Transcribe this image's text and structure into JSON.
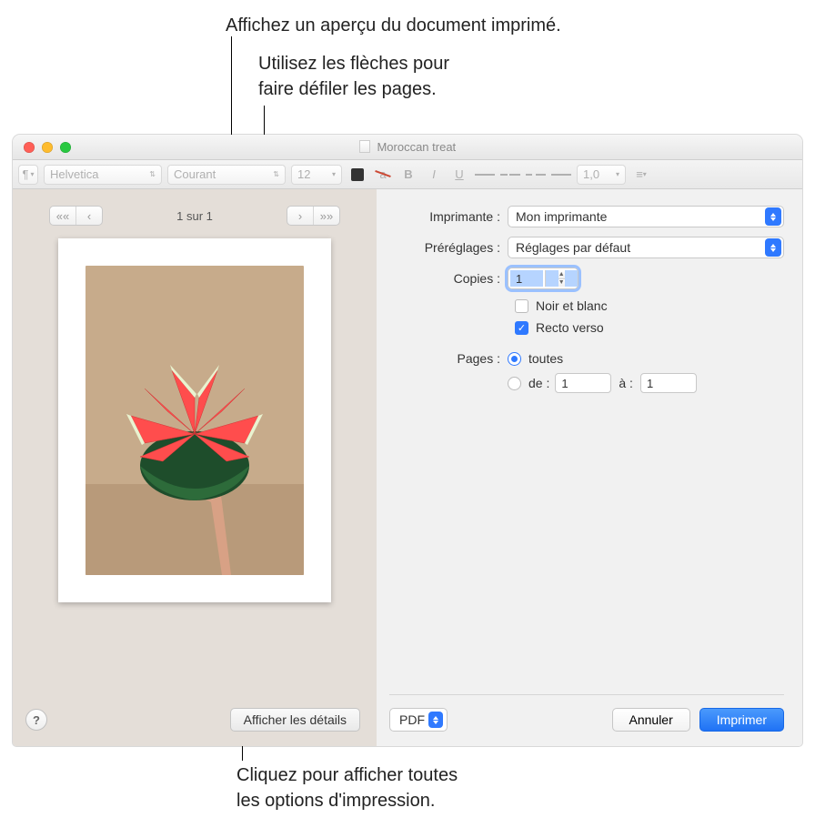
{
  "callouts": {
    "preview": "Affichez un aperçu du document imprimé.",
    "arrows_l1": "Utilisez les flèches pour",
    "arrows_l2": "faire défiler les pages.",
    "details_l1": "Cliquez pour afficher toutes",
    "details_l2": "les options d'impression."
  },
  "window": {
    "title": "Moroccan treat"
  },
  "toolbar": {
    "font": "Helvetica",
    "style": "Courant",
    "size": "12",
    "line_spacing": "1,0"
  },
  "pager": {
    "indicator": "1 sur 1"
  },
  "form": {
    "printer_label": "Imprimante :",
    "printer_value": "Mon imprimante",
    "presets_label": "Préréglages :",
    "presets_value": "Réglages par défaut",
    "copies_label": "Copies :",
    "copies_value": "1",
    "bw_label": "Noir et blanc",
    "duplex_label": "Recto verso",
    "pages_label": "Pages :",
    "pages_all": "toutes",
    "pages_from": "de :",
    "pages_from_value": "1",
    "pages_to": "à :",
    "pages_to_value": "1"
  },
  "buttons": {
    "show_details": "Afficher les détails",
    "pdf": "PDF",
    "cancel": "Annuler",
    "print": "Imprimer"
  },
  "help": "?"
}
